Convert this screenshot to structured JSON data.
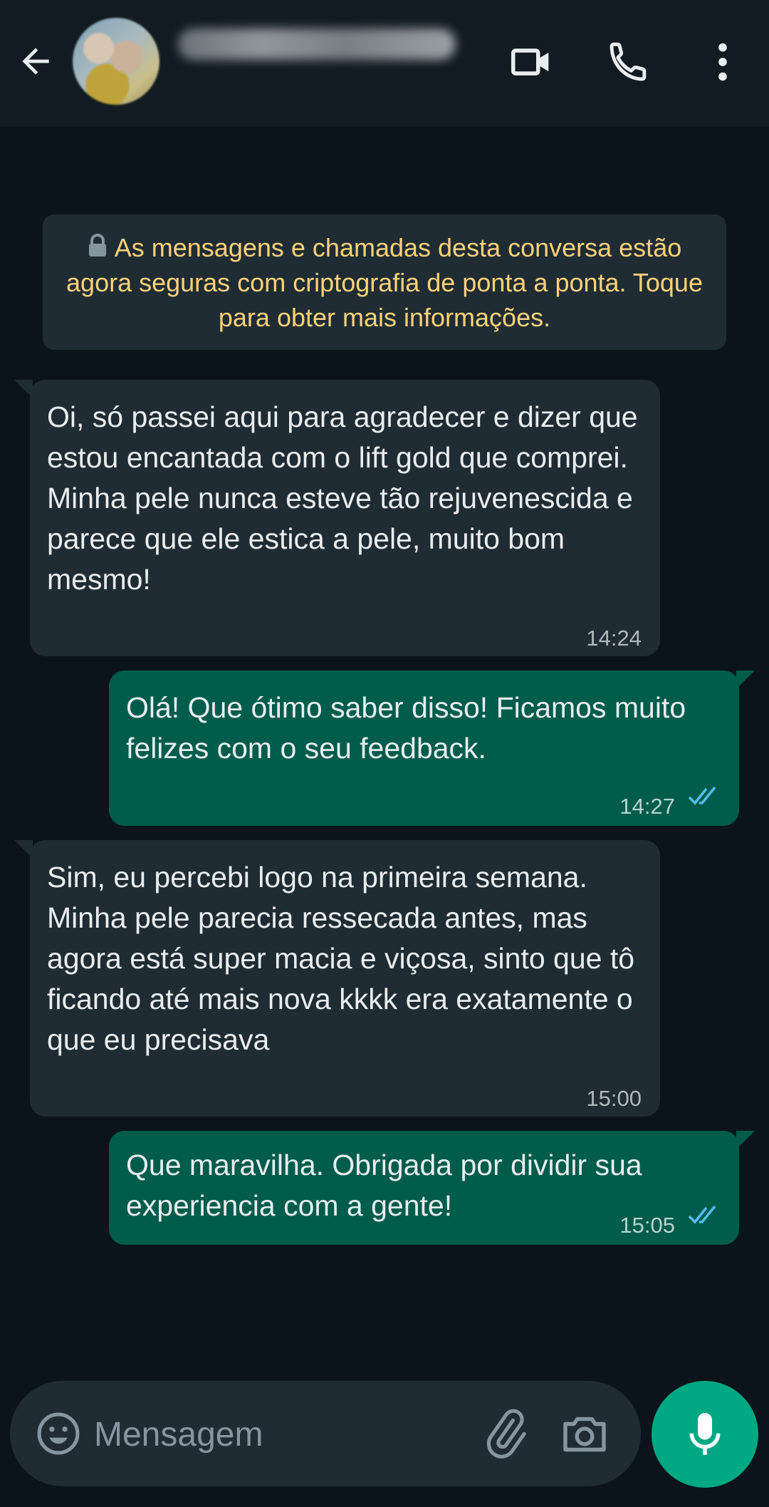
{
  "colors": {
    "header_bg": "#111b21",
    "chat_bg": "#0b141a",
    "incoming_bubble": "#202c33",
    "outgoing_bubble": "#005c4b",
    "notice_text": "#ffd279",
    "read_tick": "#53bdeb",
    "mic_button": "#00a884"
  },
  "header": {
    "back_icon": "arrow-left-icon",
    "video_icon": "videocam-icon",
    "call_icon": "phone-icon",
    "menu_icon": "more-vert-icon"
  },
  "e2e_notice": {
    "text": "As mensagens e chamadas desta conversa estão agora seguras com criptografia de ponta a ponta. Toque para obter mais informações."
  },
  "messages": [
    {
      "direction": "in",
      "text": "Oi, só passei aqui para agradecer e dizer que estou encantada com o lift gold que comprei. Minha pele nunca esteve tão rejuvenescida e parece que ele estica a pele, muito bom mesmo!",
      "time": "14:24"
    },
    {
      "direction": "out",
      "text": "Olá! Que ótimo saber disso! Ficamos muito felizes com o seu feedback.",
      "time": "14:27",
      "status": "read"
    },
    {
      "direction": "in",
      "text": "Sim, eu percebi logo na primeira semana. Minha pele parecia ressecada antes, mas agora está super macia e viçosa, sinto que tô ficando até mais nova kkkk era exatamente o que eu precisava",
      "time": "15:00"
    },
    {
      "direction": "out",
      "text": "Que maravilha. Obrigada por dividir sua experiencia com a gente!",
      "time": "15:05",
      "status": "read"
    }
  ],
  "input": {
    "placeholder": "Mensagem",
    "emoji_icon": "emoji-icon",
    "attach_icon": "paperclip-icon",
    "camera_icon": "camera-icon",
    "mic_icon": "mic-icon"
  }
}
